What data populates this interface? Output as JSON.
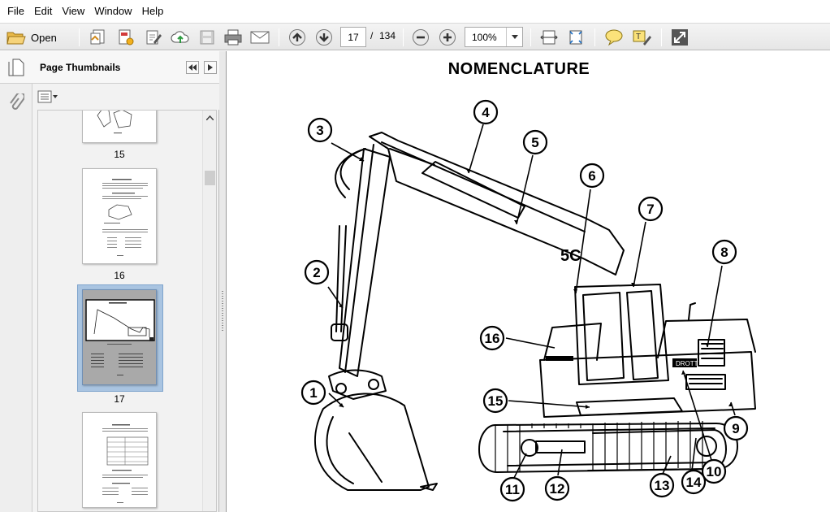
{
  "menu": [
    "File",
    "Edit",
    "View",
    "Window",
    "Help"
  ],
  "toolbar": {
    "open_label": "Open",
    "current_page": "17",
    "page_separator": "/",
    "total_pages": "134",
    "zoom": "100%"
  },
  "icons": {
    "open": "folder-open-icon",
    "create": "create-pdf-icon",
    "export": "export-pdf-icon",
    "edit": "edit-pdf-icon",
    "upload": "cloud-upload-icon",
    "save": "save-icon",
    "print": "print-icon",
    "email": "email-icon",
    "prev": "arrow-up-icon",
    "next": "arrow-down-icon",
    "zoom_out": "zoom-out-icon",
    "zoom_in": "zoom-in-icon",
    "fit_width": "fit-width-icon",
    "fit_page": "fit-page-icon",
    "comment": "comment-icon",
    "highlight": "highlight-icon",
    "expand": "expand-icon"
  },
  "thumbnails_panel": {
    "title": "Page Thumbnails",
    "pages": [
      {
        "label": "15"
      },
      {
        "label": "16"
      },
      {
        "label": "17",
        "selected": true
      },
      {
        "label": ""
      }
    ]
  },
  "document": {
    "heading": "NOMENCLATURE",
    "callouts": [
      "1",
      "2",
      "3",
      "4",
      "5",
      "6",
      "7",
      "8",
      "9",
      "10",
      "11",
      "12",
      "13",
      "14",
      "15",
      "16"
    ]
  },
  "colors": {
    "selection": "#a9c4e1",
    "toolbar_bg": "#ececec",
    "panel_bg": "#f2f2f2"
  }
}
